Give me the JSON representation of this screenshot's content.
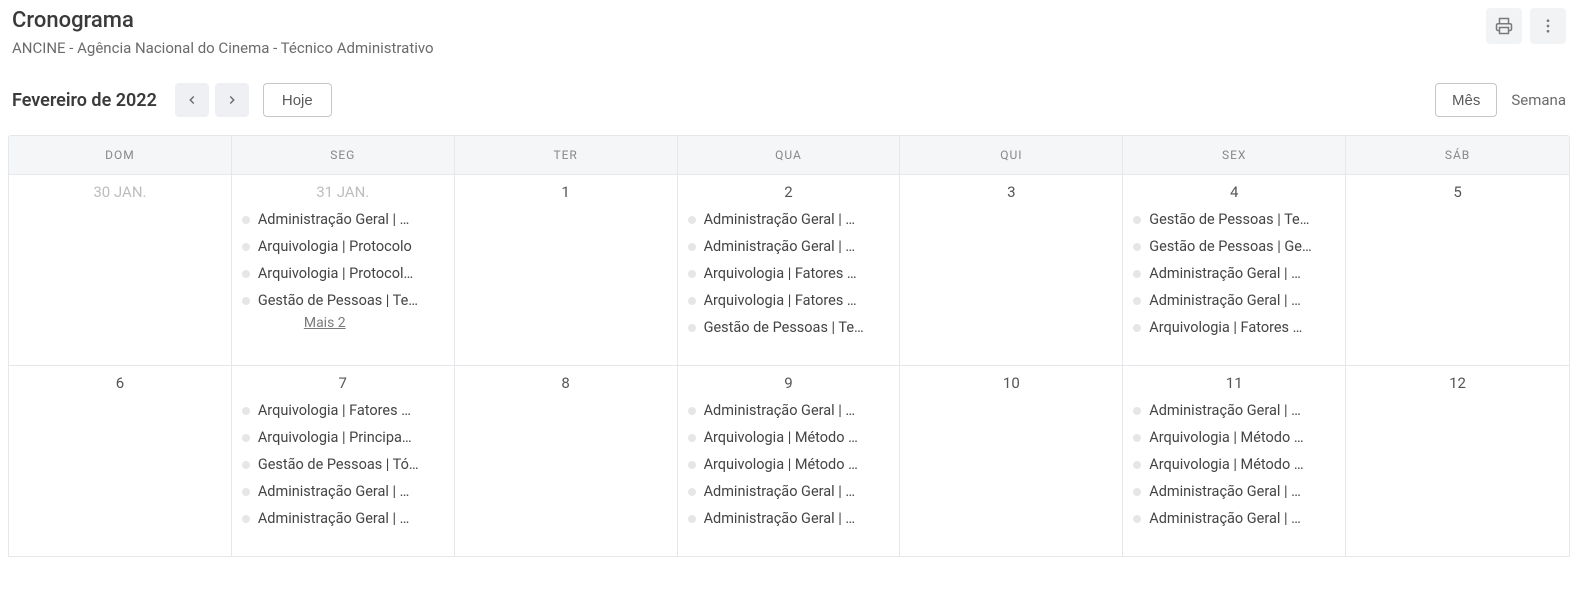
{
  "header": {
    "title": "Cronograma",
    "subtitle": "ANCINE - Agência Nacional do Cinema - Técnico Administrativo"
  },
  "toolbar": {
    "month_label": "Fevereiro de 2022",
    "today_label": "Hoje",
    "view_month": "Mês",
    "view_week": "Semana"
  },
  "weekdays": [
    "DOM",
    "SEG",
    "TER",
    "QUA",
    "QUI",
    "SEX",
    "SÁB"
  ],
  "rows": [
    {
      "cells": [
        {
          "label": "30 JAN.",
          "other": true,
          "events": [],
          "more": null
        },
        {
          "label": "31 JAN.",
          "other": true,
          "events": [
            "Administração Geral | …",
            "Arquivologia | Protocolo",
            "Arquivologia | Protocol…",
            "Gestão de Pessoas | Te…"
          ],
          "more": "Mais 2"
        },
        {
          "label": "1",
          "other": false,
          "events": [],
          "more": null
        },
        {
          "label": "2",
          "other": false,
          "events": [
            "Administração Geral | …",
            "Administração Geral | …",
            "Arquivologia | Fatores …",
            "Arquivologia | Fatores …",
            "Gestão de Pessoas | Te…"
          ],
          "more": null
        },
        {
          "label": "3",
          "other": false,
          "events": [],
          "more": null
        },
        {
          "label": "4",
          "other": false,
          "events": [
            "Gestão de Pessoas | Te…",
            "Gestão de Pessoas | Ge…",
            "Administração Geral | …",
            "Administração Geral | …",
            "Arquivologia | Fatores …"
          ],
          "more": null
        },
        {
          "label": "5",
          "other": false,
          "events": [],
          "more": null
        }
      ]
    },
    {
      "cells": [
        {
          "label": "6",
          "other": false,
          "events": [],
          "more": null
        },
        {
          "label": "7",
          "other": false,
          "events": [
            "Arquivologia | Fatores …",
            "Arquivologia | Principa…",
            "Gestão de Pessoas | Tó…",
            "Administração Geral | …",
            "Administração Geral | …"
          ],
          "more": null
        },
        {
          "label": "8",
          "other": false,
          "events": [],
          "more": null
        },
        {
          "label": "9",
          "other": false,
          "events": [
            "Administração Geral | …",
            "Arquivologia | Método …",
            "Arquivologia | Método …",
            "Administração Geral | …",
            "Administração Geral | …"
          ],
          "more": null
        },
        {
          "label": "10",
          "other": false,
          "events": [],
          "more": null
        },
        {
          "label": "11",
          "other": false,
          "events": [
            "Administração Geral | …",
            "Arquivologia | Método …",
            "Arquivologia | Método …",
            "Administração Geral | …",
            "Administração Geral | …"
          ],
          "more": null
        },
        {
          "label": "12",
          "other": false,
          "events": [],
          "more": null
        }
      ]
    }
  ]
}
